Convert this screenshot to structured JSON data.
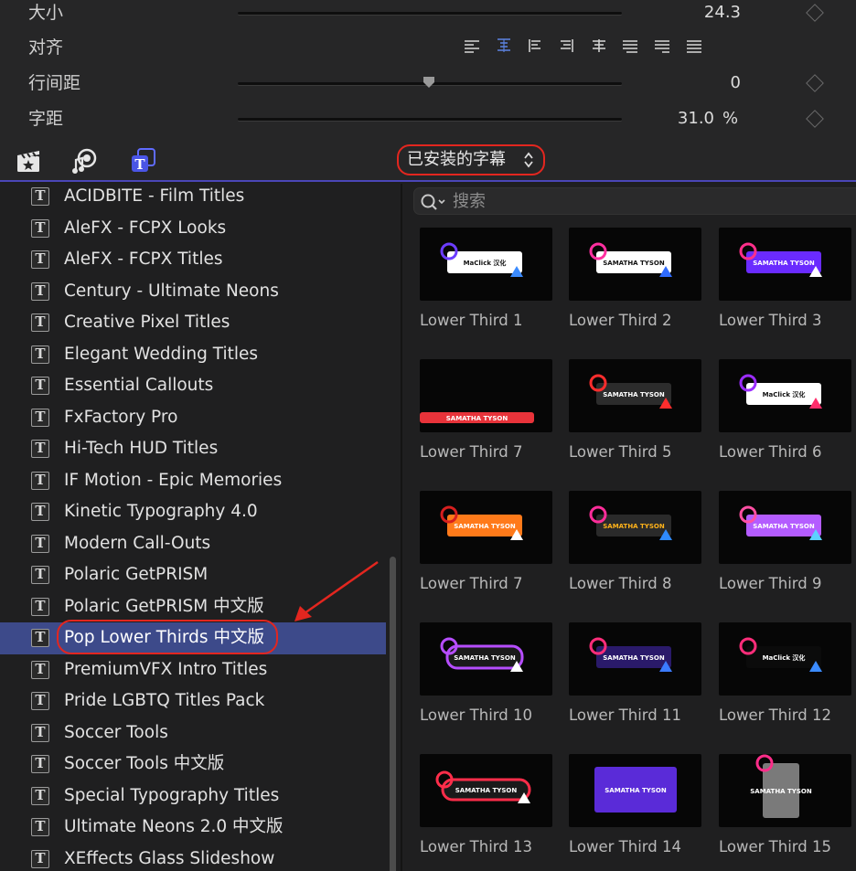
{
  "inspector": {
    "size": {
      "label": "大小",
      "value": "24.3"
    },
    "alignment": {
      "label": "对齐"
    },
    "line_spacing": {
      "label": "行间距",
      "value": "0"
    },
    "tracking": {
      "label": "字距",
      "value": "31.0",
      "unit": "%"
    }
  },
  "toolbar": {
    "installed_titles_label": "已安装的字幕"
  },
  "sidebar": {
    "items": [
      {
        "label": "ACIDBITE - Film Titles"
      },
      {
        "label": "AleFX - FCPX Looks"
      },
      {
        "label": "AleFX - FCPX Titles"
      },
      {
        "label": "Century - Ultimate Neons"
      },
      {
        "label": "Creative Pixel Titles"
      },
      {
        "label": "Elegant Wedding Titles"
      },
      {
        "label": "Essential Callouts"
      },
      {
        "label": "FxFactory Pro"
      },
      {
        "label": "Hi-Tech HUD Titles"
      },
      {
        "label": "IF Motion - Epic Memories"
      },
      {
        "label": "Kinetic Typography 4.0"
      },
      {
        "label": "Modern Call-Outs"
      },
      {
        "label": "Polaric GetPRISM"
      },
      {
        "label": "Polaric GetPRISM 中文版"
      },
      {
        "label": "Pop Lower Thirds 中文版",
        "selected": true
      },
      {
        "label": "PremiumVFX Intro Titles"
      },
      {
        "label": "Pride LGBTQ Titles Pack"
      },
      {
        "label": "Soccer Tools"
      },
      {
        "label": "Soccer Tools 中文版"
      },
      {
        "label": "Special Typography Titles"
      },
      {
        "label": "Ultimate Neons 2.0 中文版"
      },
      {
        "label": "XEffects Glass Slideshow"
      }
    ]
  },
  "browser": {
    "search_placeholder": "搜索",
    "thumbnails": [
      {
        "caption": "Lower Third 1",
        "text": "MaClick 汉化"
      },
      {
        "caption": "Lower Third 2",
        "text": "SAMATHA TYSON"
      },
      {
        "caption": "Lower Third 3",
        "text": "SAMATHA TYSON"
      },
      {
        "caption": "Lower Third 7",
        "text": "SAMATHA TYSON"
      },
      {
        "caption": "Lower Third 5",
        "text": "SAMATHA TYSON"
      },
      {
        "caption": "Lower Third 6",
        "text": "MaClick 汉化"
      },
      {
        "caption": "Lower Third 7",
        "text": "SAMATHA TYSON"
      },
      {
        "caption": "Lower Third 8",
        "text": "SAMATHA TYSON"
      },
      {
        "caption": "Lower Third 9",
        "text": "SAMATHA TYSON"
      },
      {
        "caption": "Lower Third 10",
        "text": "SAMATHA TYSON"
      },
      {
        "caption": "Lower Third 11",
        "text": "SAMATHA TYSON"
      },
      {
        "caption": "Lower Third 12",
        "text": "MaClick 汉化"
      },
      {
        "caption": "Lower Third 13",
        "text": "SAMATHA TYSON"
      },
      {
        "caption": "Lower Third 14",
        "text": "SAMATHA TYSON"
      },
      {
        "caption": "Lower Third 15",
        "text": "SAMATHA TYSON"
      }
    ]
  },
  "colors": {
    "accent": "#4a46b7",
    "selection": "#3d4a8a",
    "annotation_red": "#e3261f"
  }
}
